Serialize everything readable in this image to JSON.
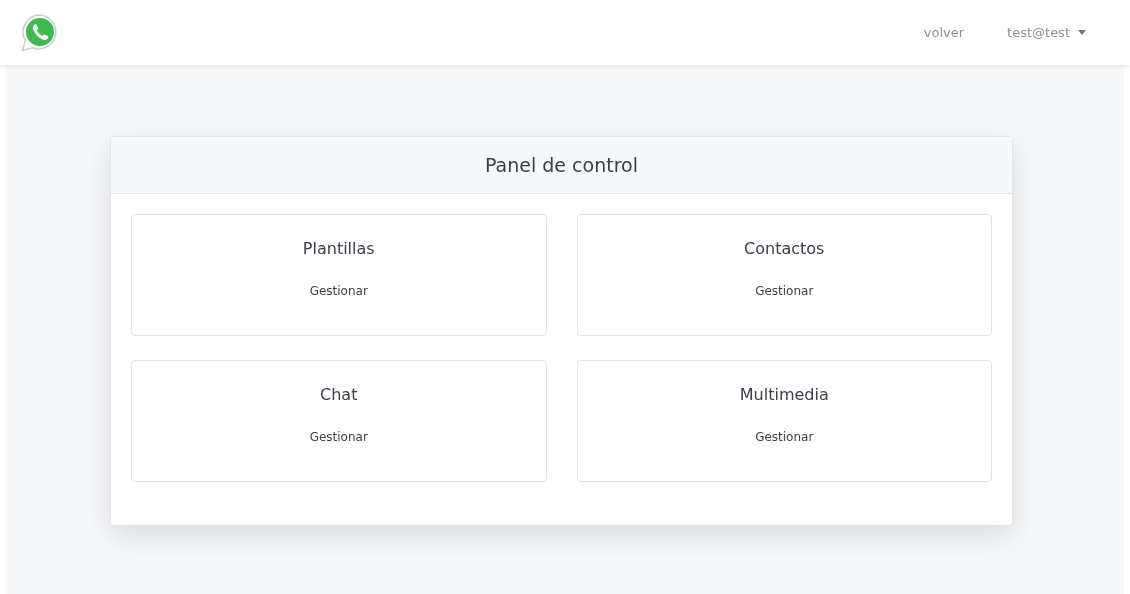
{
  "navbar": {
    "links": [
      "volver"
    ],
    "user_menu": "test@test"
  },
  "panel": {
    "title": "Panel de control",
    "tiles": [
      {
        "title": "Plantillas",
        "action": "Gestionar"
      },
      {
        "title": "Contactos",
        "action": "Gestionar"
      },
      {
        "title": "Chat",
        "action": "Gestionar"
      },
      {
        "title": "Multimedia",
        "action": "Gestionar"
      }
    ]
  }
}
